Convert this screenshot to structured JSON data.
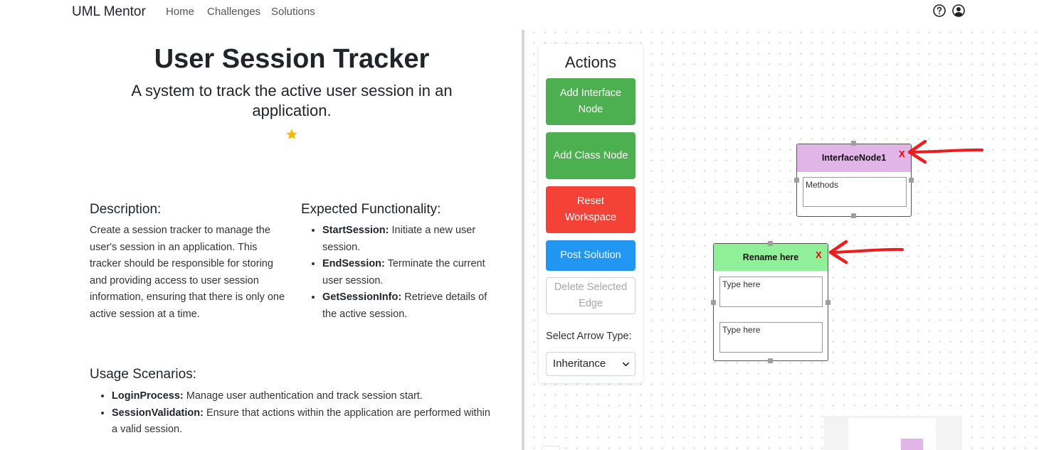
{
  "nav": {
    "brand": "UML Mentor",
    "links": [
      "Home",
      "Challenges",
      "Solutions"
    ]
  },
  "challenge": {
    "title": "User Session Tracker",
    "subtitle": "A system to track the active user session in an application.",
    "description_heading": "Description:",
    "description": "Create a session tracker to manage the user's session in an application. This tracker should be responsible for storing and providing access to user session information, ensuring that there is only one active session at a time.",
    "functionality_heading": "Expected Functionality:",
    "functionality": [
      {
        "name": "StartSession:",
        "text": " Initiate a new user session."
      },
      {
        "name": "EndSession:",
        "text": " Terminate the current user session."
      },
      {
        "name": "GetSessionInfo:",
        "text": " Retrieve details of the active session."
      }
    ],
    "usage_heading": "Usage Scenarios:",
    "usage": [
      {
        "name": "LoginProcess:",
        "text": " Manage user authentication and track session start."
      },
      {
        "name": "SessionValidation:",
        "text": " Ensure that actions within the application are performed within a valid session."
      }
    ]
  },
  "actions": {
    "title": "Actions",
    "add_interface": "Add Interface Node",
    "add_class": "Add Class Node",
    "reset": "Reset Workspace",
    "post": "Post Solution",
    "delete_edge": "Delete Selected Edge",
    "arrow_label": "Select Arrow Type:",
    "arrow_value": "Inheritance"
  },
  "nodes": {
    "interface": {
      "title": "InterfaceNode1",
      "close": "X",
      "methods_placeholder": "Methods"
    },
    "class": {
      "title": "Rename here",
      "close": "X",
      "field1_placeholder": "Type here",
      "field2_placeholder": "Type here"
    }
  },
  "colors": {
    "green": "#4caf50",
    "red": "#f44336",
    "blue": "#2196f3",
    "interface_header": "#e1b5e8",
    "class_header": "#90f09a",
    "star": "#f5b800",
    "annotation_arrow": "#ee1c1c"
  }
}
